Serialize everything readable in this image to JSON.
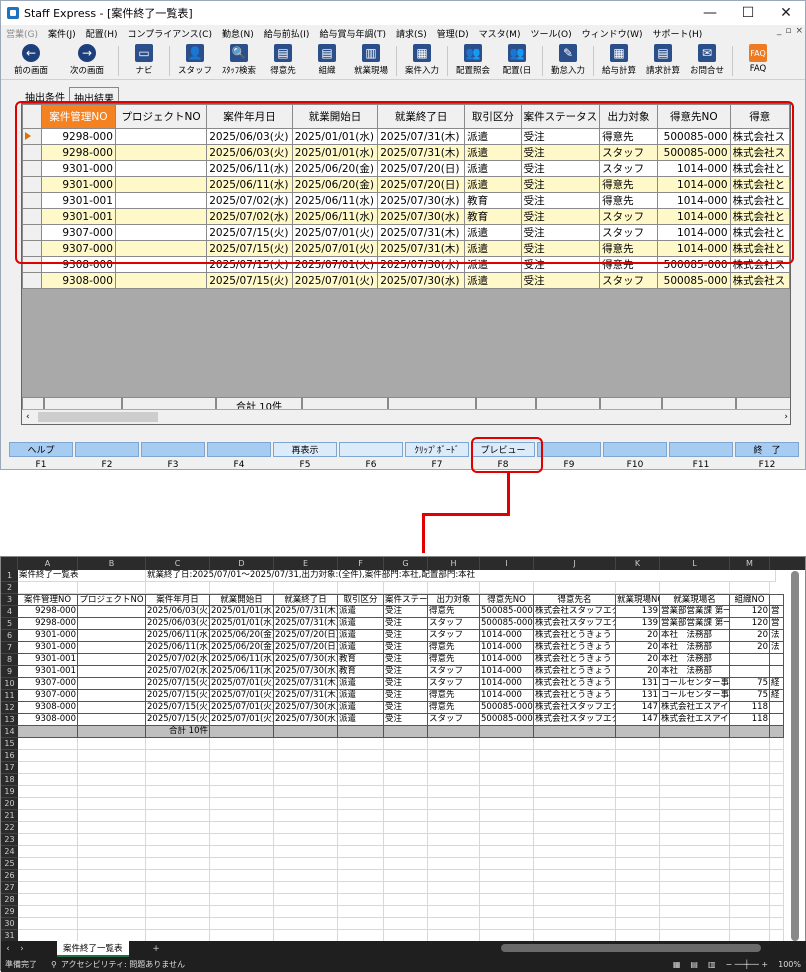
{
  "window": {
    "title": "Staff Express - [案件終了一覧表]",
    "controls": [
      "—",
      "☐",
      "✕"
    ]
  },
  "menu": [
    "営業(G)",
    "案件(J)",
    "配置(H)",
    "コンプライアンス(C)",
    "勤怠(N)",
    "給与前払(I)",
    "給与賞与年調(T)",
    "請求(S)",
    "管理(D)",
    "マスタ(M)",
    "ツール(O)",
    "ウィンドウ(W)",
    "サポート(H)"
  ],
  "toolbar": [
    {
      "label": "前の画面",
      "icon": "back-arrow-icon",
      "glyph": "←"
    },
    {
      "label": "次の画面",
      "icon": "forward-arrow-icon",
      "glyph": "→"
    },
    {
      "label": "ナビ",
      "icon": "monitor-icon",
      "glyph": "▭"
    },
    {
      "label": "スタッフ",
      "icon": "staff-icon",
      "glyph": "👤"
    },
    {
      "label": "ｽﾀｯﾌ検索",
      "icon": "staff-search-icon",
      "glyph": "🔍"
    },
    {
      "label": "得意先",
      "icon": "customer-icon",
      "glyph": "▤"
    },
    {
      "label": "組織",
      "icon": "organization-icon",
      "glyph": "▤"
    },
    {
      "label": "就業現場",
      "icon": "worksite-icon",
      "glyph": "▥"
    },
    {
      "label": "案件入力",
      "icon": "case-input-icon",
      "glyph": "▦"
    },
    {
      "label": "配置照会",
      "icon": "placement-query-icon",
      "glyph": "👥"
    },
    {
      "label": "配置(日",
      "icon": "placement-daily-icon",
      "glyph": "👥"
    },
    {
      "label": "勤怠入力",
      "icon": "attendance-icon",
      "glyph": "✎"
    },
    {
      "label": "給与計算",
      "icon": "payroll-icon",
      "glyph": "▦"
    },
    {
      "label": "請求計算",
      "icon": "billing-icon",
      "glyph": "▤"
    },
    {
      "label": "お問合せ",
      "icon": "inquiry-icon",
      "glyph": "✉"
    },
    {
      "label": "FAQ",
      "icon": "faq-icon",
      "glyph": "FAQ"
    }
  ],
  "tabs": {
    "conditions": "抽出条件",
    "results": "抽出結果"
  },
  "grid": {
    "columns": [
      "案件管理NO",
      "プロジェクトNO",
      "案件年月日",
      "就業開始日",
      "就業終了日",
      "取引区分",
      "案件ステータス",
      "出力対象",
      "得意先NO",
      "得意"
    ],
    "rows": [
      [
        "9298-000",
        "",
        "2025/06/03(火)",
        "2025/01/01(水)",
        "2025/07/31(木)",
        "派遣",
        "受注",
        "得意先",
        "500085-000",
        "株式会社ス"
      ],
      [
        "9298-000",
        "",
        "2025/06/03(火)",
        "2025/01/01(水)",
        "2025/07/31(木)",
        "派遣",
        "受注",
        "スタッフ",
        "500085-000",
        "株式会社ス"
      ],
      [
        "9301-000",
        "",
        "2025/06/11(水)",
        "2025/06/20(金)",
        "2025/07/20(日)",
        "派遣",
        "受注",
        "スタッフ",
        "1014-000",
        "株式会社と"
      ],
      [
        "9301-000",
        "",
        "2025/06/11(水)",
        "2025/06/20(金)",
        "2025/07/20(日)",
        "派遣",
        "受注",
        "得意先",
        "1014-000",
        "株式会社と"
      ],
      [
        "9301-001",
        "",
        "2025/07/02(水)",
        "2025/06/11(水)",
        "2025/07/30(水)",
        "教育",
        "受注",
        "得意先",
        "1014-000",
        "株式会社と"
      ],
      [
        "9301-001",
        "",
        "2025/07/02(水)",
        "2025/06/11(水)",
        "2025/07/30(水)",
        "教育",
        "受注",
        "スタッフ",
        "1014-000",
        "株式会社と"
      ],
      [
        "9307-000",
        "",
        "2025/07/15(火)",
        "2025/07/01(火)",
        "2025/07/31(木)",
        "派遣",
        "受注",
        "スタッフ",
        "1014-000",
        "株式会社と"
      ],
      [
        "9307-000",
        "",
        "2025/07/15(火)",
        "2025/07/01(火)",
        "2025/07/31(木)",
        "派遣",
        "受注",
        "得意先",
        "1014-000",
        "株式会社と"
      ],
      [
        "9308-000",
        "",
        "2025/07/15(火)",
        "2025/07/01(火)",
        "2025/07/30(水)",
        "派遣",
        "受注",
        "得意先",
        "500085-000",
        "株式会社ス"
      ],
      [
        "9308-000",
        "",
        "2025/07/15(火)",
        "2025/07/01(火)",
        "2025/07/30(水)",
        "派遣",
        "受注",
        "スタッフ",
        "500085-000",
        "株式会社ス"
      ]
    ],
    "total_label": "合計 10件"
  },
  "fkeys": [
    {
      "label": "ヘルプ",
      "key": "F1"
    },
    {
      "label": "",
      "key": "F2"
    },
    {
      "label": "",
      "key": "F3"
    },
    {
      "label": "",
      "key": "F4"
    },
    {
      "label": "再表示",
      "key": "F5"
    },
    {
      "label": "",
      "key": "F6"
    },
    {
      "label": "ｸﾘｯﾌﾟﾎﾞｰﾄﾞ",
      "key": "F7"
    },
    {
      "label": "プレビュー",
      "key": "F8"
    },
    {
      "label": "",
      "key": "F9"
    },
    {
      "label": "",
      "key": "F10"
    },
    {
      "label": "",
      "key": "F11"
    },
    {
      "label": "終　了",
      "key": "F12"
    }
  ],
  "excel": {
    "col_letters": [
      "A",
      "B",
      "C",
      "D",
      "E",
      "F",
      "G",
      "H",
      "I",
      "J",
      "K",
      "L",
      "M"
    ],
    "row1_title": "案件終了一覧表",
    "row1_condition": "就業終了日:2025/07/01～2025/07/31,出力対象:(全件),案件部門:本社,配置部門:本社",
    "headers": [
      "案件管理NO",
      "プロジェクトNO",
      "案件年月日",
      "就業開始日",
      "就業終了日",
      "取引区分",
      "案件ステータ",
      "出力対象",
      "得意先NO",
      "得意先名",
      "就業現場NO",
      "就業現場名",
      "組織NO"
    ],
    "rows": [
      [
        "9298-000",
        "",
        "2025/06/03(火)",
        "2025/01/01(水)",
        "2025/07/31(木)",
        "派遣",
        "受注",
        "得意先",
        "500085-000",
        "株式会社スタッフエク",
        "139",
        "営業部営業課 第一",
        "120",
        "営"
      ],
      [
        "9298-000",
        "",
        "2025/06/03(火)",
        "2025/01/01(水)",
        "2025/07/31(木)",
        "派遣",
        "受注",
        "スタッフ",
        "500085-000",
        "株式会社スタッフエク",
        "139",
        "営業部営業課 第一",
        "120",
        "営"
      ],
      [
        "9301-000",
        "",
        "2025/06/11(水)",
        "2025/06/20(金)",
        "2025/07/20(日)",
        "派遣",
        "受注",
        "スタッフ",
        "1014-000",
        "株式会社とうきょう",
        "20",
        "本社　法務部",
        "20",
        "法"
      ],
      [
        "9301-000",
        "",
        "2025/06/11(水)",
        "2025/06/20(金)",
        "2025/07/20(日)",
        "派遣",
        "受注",
        "得意先",
        "1014-000",
        "株式会社とうきょう",
        "20",
        "本社　法務部",
        "20",
        "法"
      ],
      [
        "9301-001",
        "",
        "2025/07/02(水)",
        "2025/06/11(水)",
        "2025/07/30(水)",
        "教育",
        "受注",
        "得意先",
        "1014-000",
        "株式会社とうきょう",
        "20",
        "本社　法務部",
        "",
        ""
      ],
      [
        "9301-001",
        "",
        "2025/07/02(水)",
        "2025/06/11(水)",
        "2025/07/30(水)",
        "教育",
        "受注",
        "スタッフ",
        "1014-000",
        "株式会社とうきょう",
        "20",
        "本社　法務部",
        "",
        ""
      ],
      [
        "9307-000",
        "",
        "2025/07/15(火)",
        "2025/07/01(火)",
        "2025/07/31(木)",
        "派遣",
        "受注",
        "スタッフ",
        "1014-000",
        "株式会社とうきょう",
        "131",
        "コールセンター事",
        "75",
        "経"
      ],
      [
        "9307-000",
        "",
        "2025/07/15(火)",
        "2025/07/01(火)",
        "2025/07/31(木)",
        "派遣",
        "受注",
        "得意先",
        "1014-000",
        "株式会社とうきょう",
        "131",
        "コールセンター事",
        "75",
        "経"
      ],
      [
        "9308-000",
        "",
        "2025/07/15(火)",
        "2025/07/01(火)",
        "2025/07/30(水)",
        "派遣",
        "受注",
        "得意先",
        "500085-000",
        "株式会社スタッフエク",
        "147",
        "株式会社エスアイ",
        "118",
        ""
      ],
      [
        "9308-000",
        "",
        "2025/07/15(火)",
        "2025/07/01(火)",
        "2025/07/30(水)",
        "派遣",
        "受注",
        "スタッフ",
        "500085-000",
        "株式会社スタッフエク",
        "147",
        "株式会社エスアイ",
        "118",
        ""
      ]
    ],
    "total_label": "合計 10件",
    "sheet_tab": "案件終了一覧表",
    "status_ready": "準備完了",
    "status_accessibility": "アクセシビリティ: 問題ありません",
    "zoom": "100%"
  },
  "colors": {
    "highlight_header": "#f58220",
    "alt_row": "#fff8c8",
    "annotation_red": "#e00000",
    "fkey_blue": "#a7ccf2"
  }
}
